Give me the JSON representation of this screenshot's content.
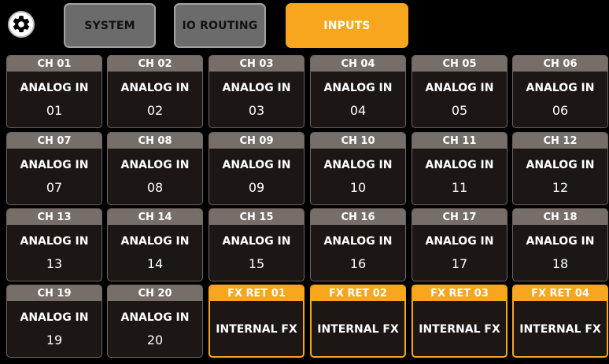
{
  "tabs": [
    {
      "label": "SYSTEM",
      "state": "inactive"
    },
    {
      "label": "IO ROUTING",
      "state": "inactive"
    },
    {
      "label": "INPUTS",
      "state": "active"
    }
  ],
  "colors": {
    "accent": "#f8a61e",
    "header_gray": "#766e69",
    "cell_bg": "#1c1715"
  },
  "icons": {
    "settings": "gear-icon"
  },
  "channels": [
    {
      "header": "CH 01",
      "line1": "ANALOG IN",
      "line2": "01"
    },
    {
      "header": "CH 02",
      "line1": "ANALOG IN",
      "line2": "02"
    },
    {
      "header": "CH 03",
      "line1": "ANALOG IN",
      "line2": "03"
    },
    {
      "header": "CH 04",
      "line1": "ANALOG IN",
      "line2": "04"
    },
    {
      "header": "CH 05",
      "line1": "ANALOG IN",
      "line2": "05"
    },
    {
      "header": "CH 06",
      "line1": "ANALOG IN",
      "line2": "06"
    },
    {
      "header": "CH 07",
      "line1": "ANALOG IN",
      "line2": "07"
    },
    {
      "header": "CH 08",
      "line1": "ANALOG IN",
      "line2": "08"
    },
    {
      "header": "CH 09",
      "line1": "ANALOG IN",
      "line2": "09"
    },
    {
      "header": "CH 10",
      "line1": "ANALOG IN",
      "line2": "10"
    },
    {
      "header": "CH 11",
      "line1": "ANALOG IN",
      "line2": "11"
    },
    {
      "header": "CH 12",
      "line1": "ANALOG IN",
      "line2": "12"
    },
    {
      "header": "CH 13",
      "line1": "ANALOG IN",
      "line2": "13"
    },
    {
      "header": "CH 14",
      "line1": "ANALOG IN",
      "line2": "14"
    },
    {
      "header": "CH 15",
      "line1": "ANALOG IN",
      "line2": "15"
    },
    {
      "header": "CH 16",
      "line1": "ANALOG IN",
      "line2": "16"
    },
    {
      "header": "CH 17",
      "line1": "ANALOG IN",
      "line2": "17"
    },
    {
      "header": "CH 18",
      "line1": "ANALOG IN",
      "line2": "18"
    },
    {
      "header": "CH 19",
      "line1": "ANALOG IN",
      "line2": "19"
    },
    {
      "header": "CH 20",
      "line1": "ANALOG IN",
      "line2": "20"
    },
    {
      "header": "FX RET 01",
      "line1": "INTERNAL FX",
      "line2": "",
      "fx": true
    },
    {
      "header": "FX RET 02",
      "line1": "INTERNAL FX",
      "line2": "",
      "fx": true
    },
    {
      "header": "FX RET 03",
      "line1": "INTERNAL FX",
      "line2": "",
      "fx": true
    },
    {
      "header": "FX RET 04",
      "line1": "INTERNAL FX",
      "line2": "",
      "fx": true
    }
  ]
}
